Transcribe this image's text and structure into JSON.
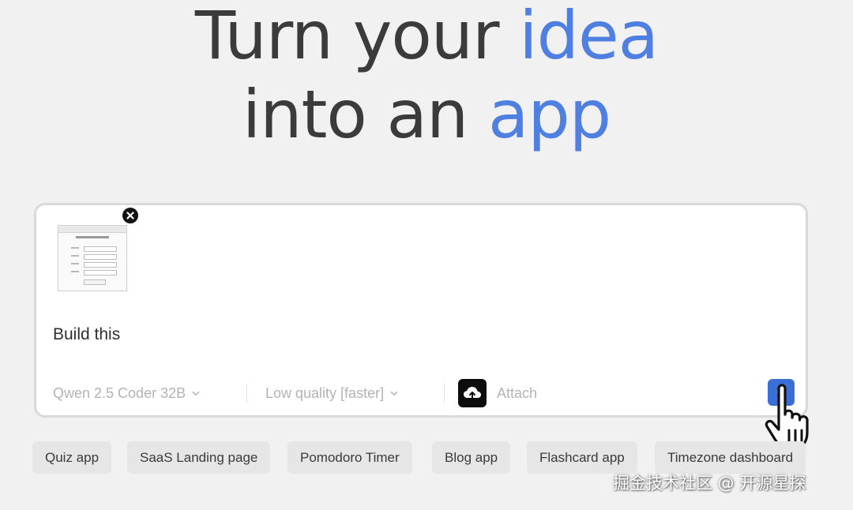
{
  "colors": {
    "accent": "#4f7fe0",
    "submit": "#3b6fd8",
    "heading": "#3b3b3b"
  },
  "hero": {
    "line1_main": "Turn your ",
    "line1_accent": "idea",
    "line2_main": "into an ",
    "line2_accent": "app"
  },
  "prompt": {
    "attachment_icon": "close-icon",
    "text": "Build this"
  },
  "toolbar": {
    "model": "Qwen 2.5 Coder 32B",
    "quality": "Low quality [faster]",
    "attach_label": "Attach",
    "attach_icon": "cloud-upload-icon",
    "submit_icon": "arrow-up-icon"
  },
  "suggestions": [
    "Quiz app",
    "SaaS Landing page",
    "Pomodoro Timer",
    "Blog app",
    "Flashcard app",
    "Timezone dashboard"
  ],
  "watermark": "掘金技术社区 @ 开源星探"
}
